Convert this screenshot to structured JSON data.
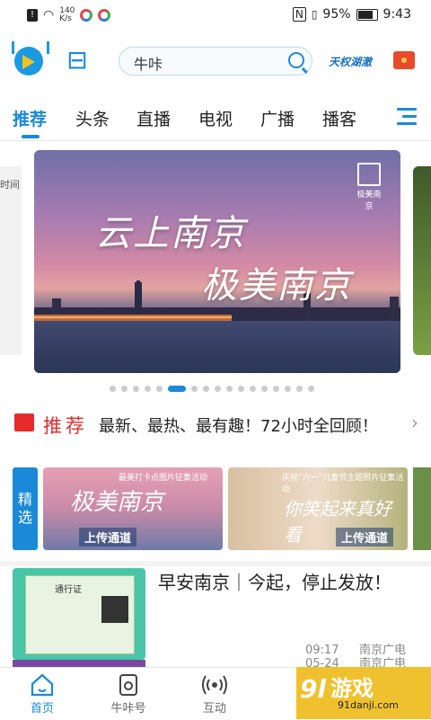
{
  "status_bar": {
    "net_speed_top": "140",
    "net_speed_unit": "K/s",
    "battery": "95%",
    "time": "9:43"
  },
  "header": {
    "search_text": "牛咔",
    "brand_text": "天权湖澈"
  },
  "tabs": [
    "推荐",
    "头条",
    "直播",
    "电视",
    "广播",
    "播客"
  ],
  "banner": {
    "title_line1": "云上南京",
    "title_line2": "极美南京",
    "logo_caption": "极美南京",
    "left_peek_text": "时间",
    "page_count": 18,
    "active_index": 5
  },
  "recommend": {
    "label": "推荐",
    "text": "最新、最热、最有趣！72小时全回顾！"
  },
  "featured": {
    "label": "精选",
    "cards": [
      {
        "title": "极美南京",
        "top_text": "最美打卡点图片征集活动",
        "upload": "上传通道"
      },
      {
        "title": "你笑起来真好看",
        "top_text": "庆祝“六一”儿童节主题照片征集活动",
        "upload": "上传通道"
      }
    ]
  },
  "news": {
    "title": "早安南京｜今起，停止发放！",
    "image_caption": "通行证",
    "time1": "09:17",
    "time2": "05-24",
    "source1": "南京广电",
    "source2": "南京广电"
  },
  "bottom_nav": [
    {
      "label": "首页",
      "icon": "home-icon"
    },
    {
      "label": "牛咔号",
      "icon": "niuka-icon"
    },
    {
      "label": "互动",
      "icon": "broadcast-icon"
    }
  ],
  "watermark": {
    "text": "游戏",
    "prefix": "9l",
    "url": "91danji.com"
  },
  "colors": {
    "accent": "#1a8ad8",
    "hot": "#e52b2b"
  }
}
